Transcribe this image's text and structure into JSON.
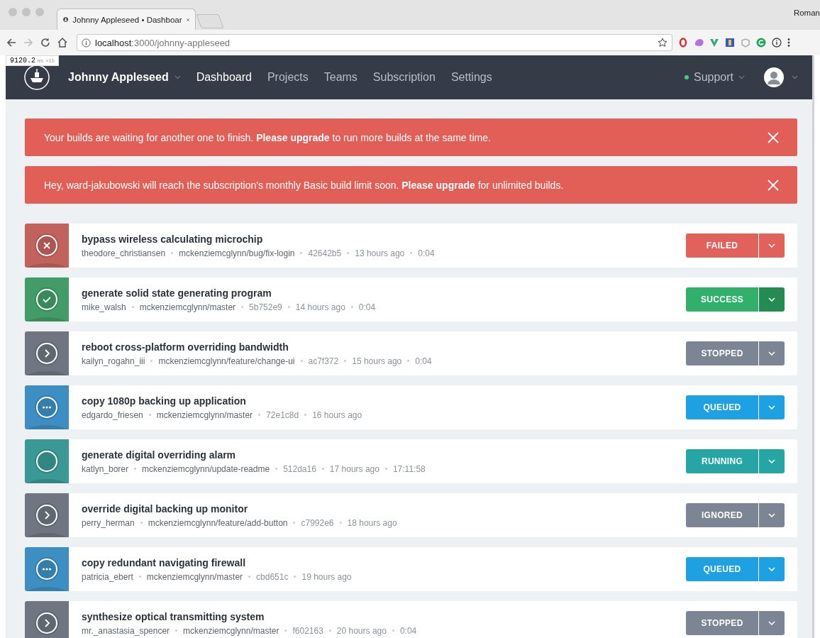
{
  "browser": {
    "tab_title": "Johnny Appleseed • Dashboar",
    "profile": "Roman",
    "url_host": "localhost",
    "url_path": ":3000/johnny-appleseed",
    "timing": {
      "value": "9120.2",
      "unit": "ms",
      "count": "×15"
    }
  },
  "nav": {
    "org": "Johnny Appleseed",
    "links": [
      {
        "label": "Dashboard",
        "selected": true
      },
      {
        "label": "Projects",
        "selected": false
      },
      {
        "label": "Teams",
        "selected": false
      },
      {
        "label": "Subscription",
        "selected": false
      },
      {
        "label": "Settings",
        "selected": false
      }
    ],
    "support": "Support"
  },
  "alerts": [
    {
      "text": "Your builds are waiting for another one to finish. **Please upgrade** to run more builds at the same time."
    },
    {
      "text": "Hey, ward-jakubowski will reach the subscription's monthly Basic build limit soon. **Please upgrade** for unlimited builds."
    }
  ],
  "builds": [
    {
      "title": "bypass wireless calculating microchip",
      "author": "theodore_christiansen",
      "branch": "mckenziemcglynn/bug/fix-login",
      "commit": "42642b5",
      "time": "13 hours ago",
      "duration": "0:04",
      "kind": "failed",
      "label": "FAILED",
      "menu_highlighted": false
    },
    {
      "title": "generate solid state generating program",
      "author": "mike_walsh",
      "branch": "mckenziemcglynn/master",
      "commit": "5b752e9",
      "time": "14 hours ago",
      "duration": "0:04",
      "kind": "success",
      "label": "SUCCESS",
      "menu_highlighted": true
    },
    {
      "title": "reboot cross-platform overriding bandwidth",
      "author": "kailyn_rogahn_iii",
      "branch": "mckenziemcglynn/feature/change-ui",
      "commit": "ac7f372",
      "time": "15 hours ago",
      "duration": "0:04",
      "kind": "stopped",
      "label": "STOPPED",
      "menu_highlighted": false
    },
    {
      "title": "copy 1080p backing up application",
      "author": "edgardo_friesen",
      "branch": "mckenziemcglynn/master",
      "commit": "72e1c8d",
      "time": "16 hours ago",
      "kind": "queued",
      "label": "QUEUED",
      "menu_highlighted": false
    },
    {
      "title": "generate digital overriding alarm",
      "author": "katlyn_borer",
      "branch": "mckenziemcglynn/update-readme",
      "commit": "512da16",
      "time": "17 hours ago",
      "duration": "17:11:58",
      "kind": "running",
      "label": "RUNNING",
      "menu_highlighted": false
    },
    {
      "title": "override digital backing up monitor",
      "author": "perry_herman",
      "branch": "mckenziemcglynn/feature/add-button",
      "commit": "c7992e6",
      "time": "18 hours ago",
      "kind": "ignored",
      "label": "IGNORED",
      "menu_highlighted": false
    },
    {
      "title": "copy redundant navigating firewall",
      "author": "patricia_ebert",
      "branch": "mckenziemcglynn/master",
      "commit": "cbd651c",
      "time": "19 hours ago",
      "kind": "queued",
      "label": "QUEUED",
      "menu_highlighted": false
    },
    {
      "title": "synthesize optical transmitting system",
      "author": "mr._anastasia_spencer",
      "branch": "mckenziemcglynn/master",
      "commit": "f602163",
      "time": "20 hours ago",
      "duration": "0:04",
      "kind": "stopped",
      "label": "STOPPED",
      "menu_highlighted": false
    }
  ]
}
